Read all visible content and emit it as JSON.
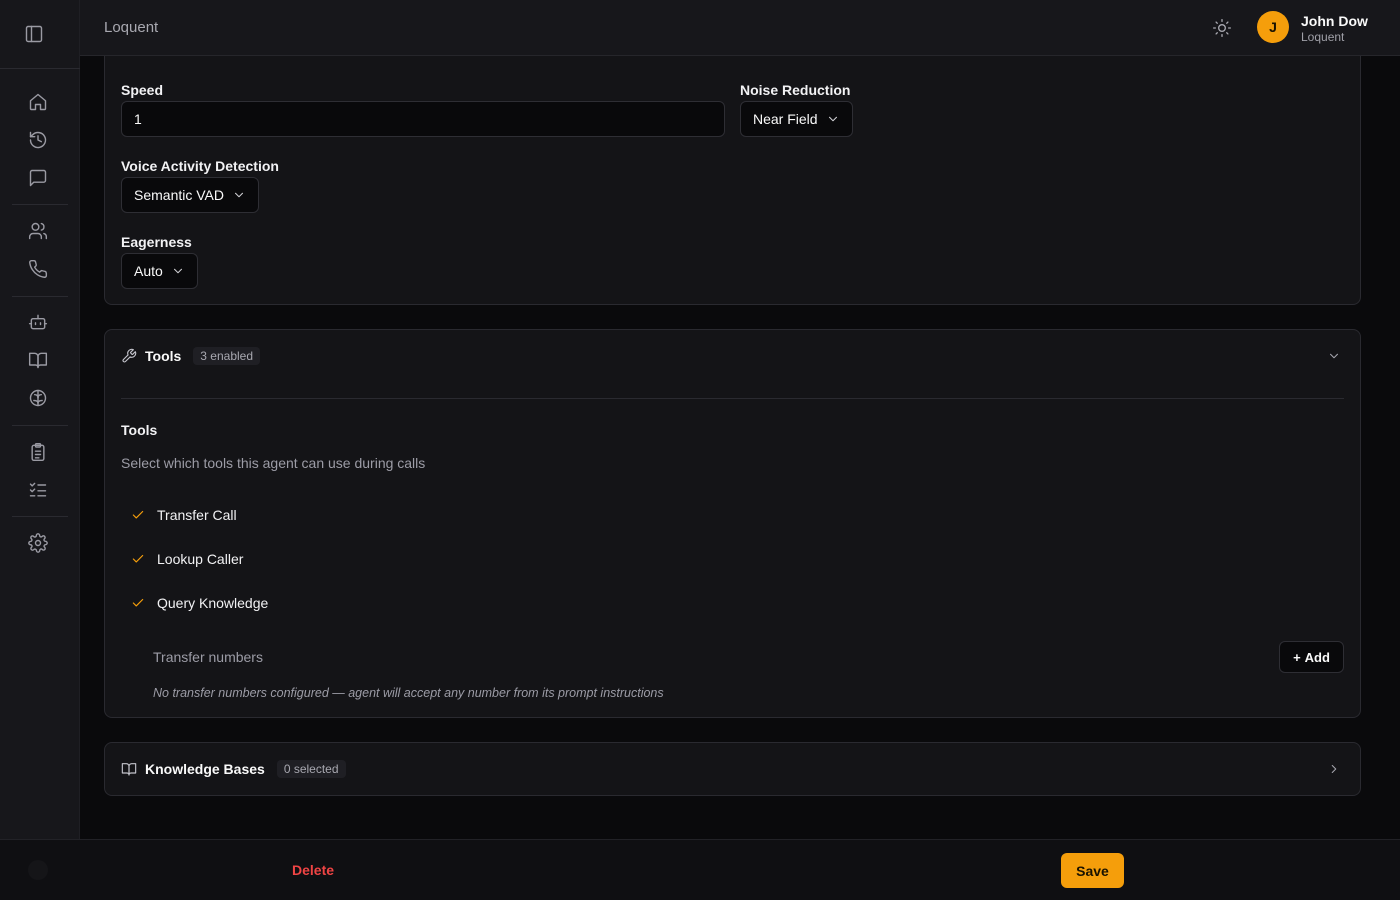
{
  "header": {
    "brand": "Loquent",
    "user": {
      "initial": "J",
      "name": "John Dow",
      "org": "Loquent"
    }
  },
  "sidebar": {
    "items": [
      {
        "icon": "home-icon"
      },
      {
        "icon": "history-icon"
      },
      {
        "icon": "chat-icon"
      },
      {
        "icon": "users-icon"
      },
      {
        "icon": "phone-icon"
      },
      {
        "icon": "bot-icon"
      },
      {
        "icon": "book-icon"
      },
      {
        "icon": "brain-icon"
      },
      {
        "icon": "clipboard-icon"
      },
      {
        "icon": "list-checks-icon"
      },
      {
        "icon": "settings-icon"
      }
    ]
  },
  "voice": {
    "speed_label": "Speed",
    "speed_value": "1",
    "noise_label": "Noise Reduction",
    "noise_value": "Near Field",
    "vad_label": "Voice Activity Detection",
    "vad_value": "Semantic VAD",
    "eagerness_label": "Eagerness",
    "eagerness_value": "Auto"
  },
  "tools": {
    "title": "Tools",
    "badge": "3 enabled",
    "sub_title": "Tools",
    "description": "Select which tools this agent can use during calls",
    "items": [
      {
        "label": "Transfer Call",
        "checked": true
      },
      {
        "label": "Lookup Caller",
        "checked": true
      },
      {
        "label": "Query Knowledge",
        "checked": true
      }
    ],
    "transfer_label": "Transfer numbers",
    "add_label": "Add",
    "empty_note": "No transfer numbers configured — agent will accept any number from its prompt instructions"
  },
  "knowledge": {
    "title": "Knowledge Bases",
    "badge": "0 selected"
  },
  "footer": {
    "delete_label": "Delete",
    "save_label": "Save"
  },
  "colors": {
    "accent": "#f59e0b",
    "danger": "#ef4444",
    "background": "#0a0a0c"
  }
}
